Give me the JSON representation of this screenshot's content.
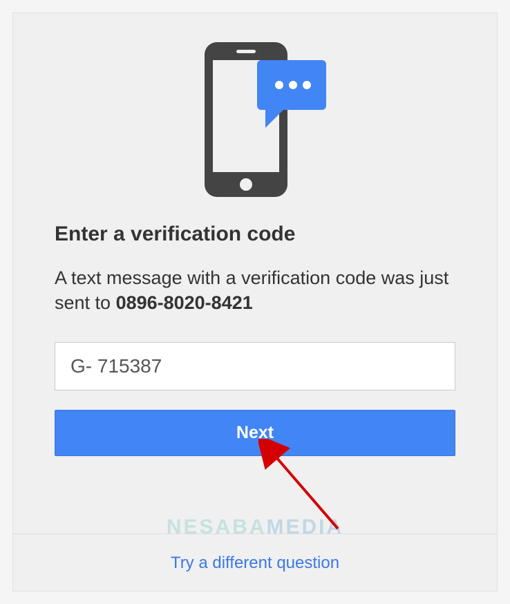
{
  "heading": "Enter a verification code",
  "subtext_prefix": "A text message with a verification code was just sent to ",
  "phone_number": "0896-8020-8421",
  "code_value": "G- 715387",
  "next_label": "Next",
  "alt_link_label": "Try a different question",
  "watermark_a": "NESABA",
  "watermark_b": "MEDIA",
  "colors": {
    "primary": "#4285f4",
    "link": "#3b78e7",
    "phone_body": "#444444",
    "bubble": "#4285f4"
  }
}
